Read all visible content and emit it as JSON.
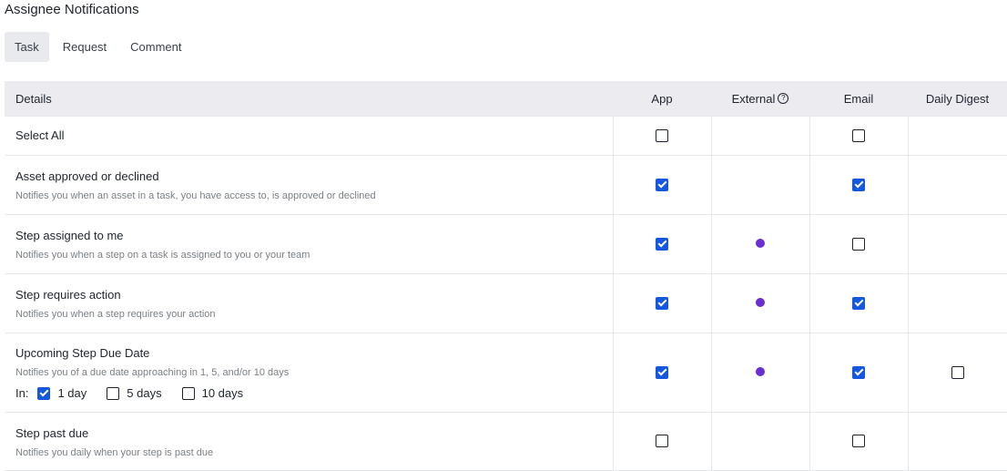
{
  "title": "Assignee Notifications",
  "tabs": [
    {
      "label": "Task",
      "active": true
    },
    {
      "label": "Request",
      "active": false
    },
    {
      "label": "Comment",
      "active": false
    }
  ],
  "headers": {
    "details": "Details",
    "app": "App",
    "external": "External",
    "email": "Email",
    "daily_digest": "Daily Digest"
  },
  "icons": {
    "external_help": "question-circle-icon",
    "external_dot": "status-dot"
  },
  "colors": {
    "checkbox_checked": "#1657e0",
    "external_dot": "#6b2fd1",
    "header_bg": "#ececf0",
    "tab_active_bg": "#e9eaee"
  },
  "rows": [
    {
      "title": "Select All",
      "desc": "",
      "app": false,
      "external": false,
      "email": false,
      "digest": null
    },
    {
      "title": "Asset approved or declined",
      "desc": "Notifies you when an asset in a task, you have access to, is approved or declined",
      "app": true,
      "external": false,
      "email": true,
      "digest": null
    },
    {
      "title": "Step assigned to me",
      "desc": "Notifies you when a step on a task is assigned to you or your team",
      "app": true,
      "external": true,
      "email": false,
      "digest": null
    },
    {
      "title": "Step requires action",
      "desc": "Notifies you when a step requires your action",
      "app": true,
      "external": true,
      "email": true,
      "digest": null
    },
    {
      "title": "Upcoming Step Due Date",
      "desc": "Notifies you of a due date approaching in 1, 5, and/or 10 days",
      "app": true,
      "external": true,
      "email": true,
      "digest": false,
      "in_label": "In:",
      "options": [
        {
          "label": "1 day",
          "checked": true
        },
        {
          "label": "5 days",
          "checked": false
        },
        {
          "label": "10 days",
          "checked": false
        }
      ]
    },
    {
      "title": "Step past due",
      "desc": "Notifies you daily when your step is past due",
      "app": false,
      "external": false,
      "email": false,
      "digest": null
    }
  ]
}
